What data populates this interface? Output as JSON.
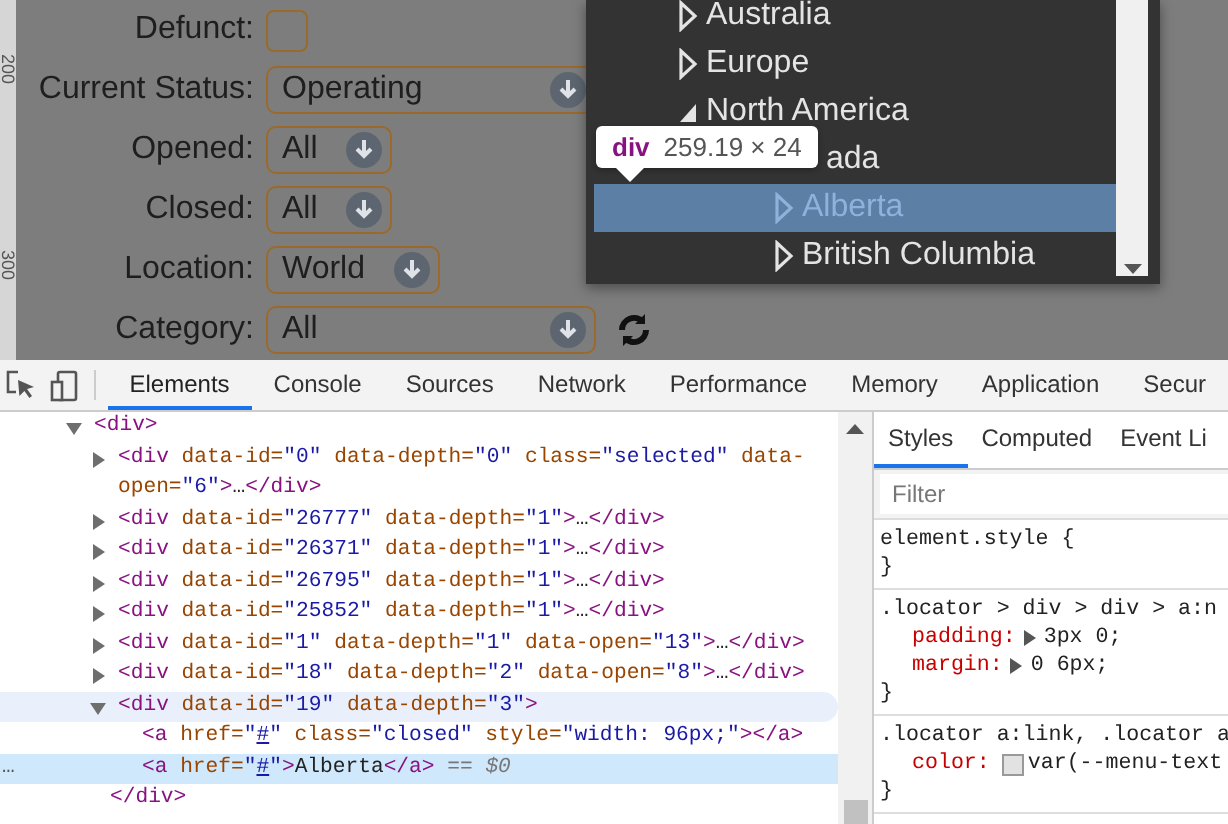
{
  "page": {
    "ruler_labels": [
      "200",
      "300"
    ],
    "form": [
      {
        "label": "Defunct:",
        "kind": "checkbox",
        "checked": false
      },
      {
        "label": "Current Status:",
        "kind": "select",
        "value": "Operating",
        "wide": true
      },
      {
        "label": "Opened:",
        "kind": "select",
        "value": "All",
        "wide": false
      },
      {
        "label": "Closed:",
        "kind": "select",
        "value": "All",
        "wide": false
      },
      {
        "label": "Location:",
        "kind": "select",
        "value": "World",
        "wide": false
      },
      {
        "label": "Category:",
        "kind": "select",
        "value": "All",
        "wide": true,
        "refresh": true
      }
    ],
    "location_menu": {
      "items": [
        {
          "label": "Australia",
          "expanded": false,
          "selected": false
        },
        {
          "label": "Europe",
          "expanded": false,
          "selected": false
        },
        {
          "label": "North America",
          "expanded": true,
          "selected": false,
          "children": [
            {
              "label": "ada",
              "selected": false,
              "children": [
                {
                  "label": "Alberta",
                  "expanded": false,
                  "selected": true
                },
                {
                  "label": "British Columbia",
                  "expanded": false,
                  "selected": false
                }
              ]
            }
          ]
        }
      ]
    },
    "tooltip": {
      "tag": "div",
      "size": "259.19 × 24"
    }
  },
  "devtools": {
    "tabs": [
      {
        "label": "Elements",
        "selected": true
      },
      {
        "label": "Console",
        "selected": false
      },
      {
        "label": "Sources",
        "selected": false
      },
      {
        "label": "Network",
        "selected": false
      },
      {
        "label": "Performance",
        "selected": false
      },
      {
        "label": "Memory",
        "selected": false
      },
      {
        "label": "Application",
        "selected": false
      },
      {
        "label": "Secur",
        "selected": false
      }
    ],
    "elements": {
      "nodes": [
        {
          "expanded": true,
          "selected": false,
          "hovered": false,
          "open": [
            {
              "kind": "tag",
              "text": "<div>"
            }
          ],
          "children": [
            {
              "expanded": false,
              "selected": false,
              "hovered": false,
              "open": [
                {
                  "kind": "tag",
                  "text": "<div"
                },
                {
                  "kind": "attr",
                  "text": " data-id="
                },
                {
                  "kind": "value",
                  "text": "\"0\""
                },
                {
                  "kind": "attr",
                  "text": " data-depth="
                },
                {
                  "kind": "value",
                  "text": "\"0\""
                },
                {
                  "kind": "attr",
                  "text": " class="
                },
                {
                  "kind": "value",
                  "text": "\"selected\""
                },
                {
                  "kind": "attr",
                  "text": " data-open="
                },
                {
                  "kind": "value",
                  "text": "\"6\""
                },
                {
                  "kind": "tag",
                  "text": ">"
                },
                {
                  "kind": "text",
                  "text": "…"
                },
                {
                  "kind": "tag",
                  "text": "</div>"
                }
              ]
            },
            {
              "expanded": false,
              "selected": false,
              "hovered": false,
              "open": [
                {
                  "kind": "tag",
                  "text": "<div"
                },
                {
                  "kind": "attr",
                  "text": " data-id="
                },
                {
                  "kind": "value",
                  "text": "\"26777\""
                },
                {
                  "kind": "attr",
                  "text": " data-depth="
                },
                {
                  "kind": "value",
                  "text": "\"1\""
                },
                {
                  "kind": "tag",
                  "text": ">"
                },
                {
                  "kind": "text",
                  "text": "…"
                },
                {
                  "kind": "tag",
                  "text": "</div>"
                }
              ]
            },
            {
              "expanded": false,
              "selected": false,
              "hovered": false,
              "open": [
                {
                  "kind": "tag",
                  "text": "<div"
                },
                {
                  "kind": "attr",
                  "text": " data-id="
                },
                {
                  "kind": "value",
                  "text": "\"26371\""
                },
                {
                  "kind": "attr",
                  "text": " data-depth="
                },
                {
                  "kind": "value",
                  "text": "\"1\""
                },
                {
                  "kind": "tag",
                  "text": ">"
                },
                {
                  "kind": "text",
                  "text": "…"
                },
                {
                  "kind": "tag",
                  "text": "</div>"
                }
              ]
            },
            {
              "expanded": false,
              "selected": false,
              "hovered": false,
              "open": [
                {
                  "kind": "tag",
                  "text": "<div"
                },
                {
                  "kind": "attr",
                  "text": " data-id="
                },
                {
                  "kind": "value",
                  "text": "\"26795\""
                },
                {
                  "kind": "attr",
                  "text": " data-depth="
                },
                {
                  "kind": "value",
                  "text": "\"1\""
                },
                {
                  "kind": "tag",
                  "text": ">"
                },
                {
                  "kind": "text",
                  "text": "…"
                },
                {
                  "kind": "tag",
                  "text": "</div>"
                }
              ]
            },
            {
              "expanded": false,
              "selected": false,
              "hovered": false,
              "open": [
                {
                  "kind": "tag",
                  "text": "<div"
                },
                {
                  "kind": "attr",
                  "text": " data-id="
                },
                {
                  "kind": "value",
                  "text": "\"25852\""
                },
                {
                  "kind": "attr",
                  "text": " data-depth="
                },
                {
                  "kind": "value",
                  "text": "\"1\""
                },
                {
                  "kind": "tag",
                  "text": ">"
                },
                {
                  "kind": "text",
                  "text": "…"
                },
                {
                  "kind": "tag",
                  "text": "</div>"
                }
              ]
            },
            {
              "expanded": false,
              "selected": false,
              "hovered": false,
              "open": [
                {
                  "kind": "tag",
                  "text": "<div"
                },
                {
                  "kind": "attr",
                  "text": " data-id="
                },
                {
                  "kind": "value",
                  "text": "\"1\""
                },
                {
                  "kind": "attr",
                  "text": " data-depth="
                },
                {
                  "kind": "value",
                  "text": "\"1\""
                },
                {
                  "kind": "attr",
                  "text": " data-open="
                },
                {
                  "kind": "value",
                  "text": "\"13\""
                },
                {
                  "kind": "tag",
                  "text": ">"
                },
                {
                  "kind": "text",
                  "text": "…"
                },
                {
                  "kind": "tag",
                  "text": "</div>"
                }
              ]
            },
            {
              "expanded": false,
              "selected": false,
              "hovered": false,
              "open": [
                {
                  "kind": "tag",
                  "text": "<div"
                },
                {
                  "kind": "attr",
                  "text": " data-id="
                },
                {
                  "kind": "value",
                  "text": "\"18\""
                },
                {
                  "kind": "attr",
                  "text": " data-depth="
                },
                {
                  "kind": "value",
                  "text": "\"2\""
                },
                {
                  "kind": "attr",
                  "text": " data-open="
                },
                {
                  "kind": "value",
                  "text": "\"8\""
                },
                {
                  "kind": "tag",
                  "text": ">"
                },
                {
                  "kind": "text",
                  "text": "…"
                },
                {
                  "kind": "tag",
                  "text": "</div>"
                }
              ]
            },
            {
              "expanded": true,
              "selected": false,
              "hovered": true,
              "open": [
                {
                  "kind": "tag",
                  "text": "<div"
                },
                {
                  "kind": "attr",
                  "text": " data-id="
                },
                {
                  "kind": "value",
                  "text": "\"19\""
                },
                {
                  "kind": "attr",
                  "text": " data-depth="
                },
                {
                  "kind": "value",
                  "text": "\"3\""
                },
                {
                  "kind": "tag",
                  "text": ">"
                }
              ],
              "children": [
                {
                  "selected": false,
                  "hovered": false,
                  "open": [
                    {
                      "kind": "tag",
                      "text": "<a"
                    },
                    {
                      "kind": "attr",
                      "text": " href="
                    },
                    {
                      "kind": "value",
                      "text": "\""
                    },
                    {
                      "kind": "link",
                      "text": "#"
                    },
                    {
                      "kind": "value",
                      "text": "\""
                    },
                    {
                      "kind": "attr",
                      "text": " class="
                    },
                    {
                      "kind": "value",
                      "text": "\"closed\""
                    },
                    {
                      "kind": "attr",
                      "text": " style="
                    },
                    {
                      "kind": "value",
                      "text": "\"width: 96px;\""
                    },
                    {
                      "kind": "tag",
                      "text": "></a>"
                    }
                  ]
                },
                {
                  "selected": true,
                  "hovered": false,
                  "gutter": "…",
                  "open": [
                    {
                      "kind": "tag",
                      "text": "<a"
                    },
                    {
                      "kind": "attr",
                      "text": " href="
                    },
                    {
                      "kind": "value",
                      "text": "\""
                    },
                    {
                      "kind": "link",
                      "text": "#"
                    },
                    {
                      "kind": "value",
                      "text": "\""
                    },
                    {
                      "kind": "tag",
                      "text": ">"
                    },
                    {
                      "kind": "text",
                      "text": "Alberta"
                    },
                    {
                      "kind": "tag",
                      "text": "</a>"
                    },
                    {
                      "kind": "dim",
                      "text": " == $0"
                    }
                  ]
                }
              ],
              "close": [
                {
                  "kind": "tag",
                  "text": "</div>"
                }
              ]
            }
          ]
        }
      ]
    },
    "styles": {
      "tabs": [
        {
          "label": "Styles",
          "selected": true
        },
        {
          "label": "Computed",
          "selected": false
        },
        {
          "label": "Event Li",
          "selected": false
        }
      ],
      "filter": {
        "placeholder": "Filter"
      },
      "rules": [
        {
          "selector": "element.style {",
          "close": "}"
        },
        {
          "selector": ".locator > div > div > a:n",
          "declarations": [
            {
              "property": "padding:",
              "value": "3px 0;",
              "kind": "expandable"
            },
            {
              "property": "margin:",
              "value": "0 6px;",
              "kind": "expandable"
            }
          ],
          "close": "}"
        },
        {
          "selector": ".locator a:link, .locator a",
          "declarations": [
            {
              "property": "color:",
              "value": "var(--menu-text",
              "kind": "color"
            }
          ],
          "close": "}"
        }
      ]
    }
  }
}
